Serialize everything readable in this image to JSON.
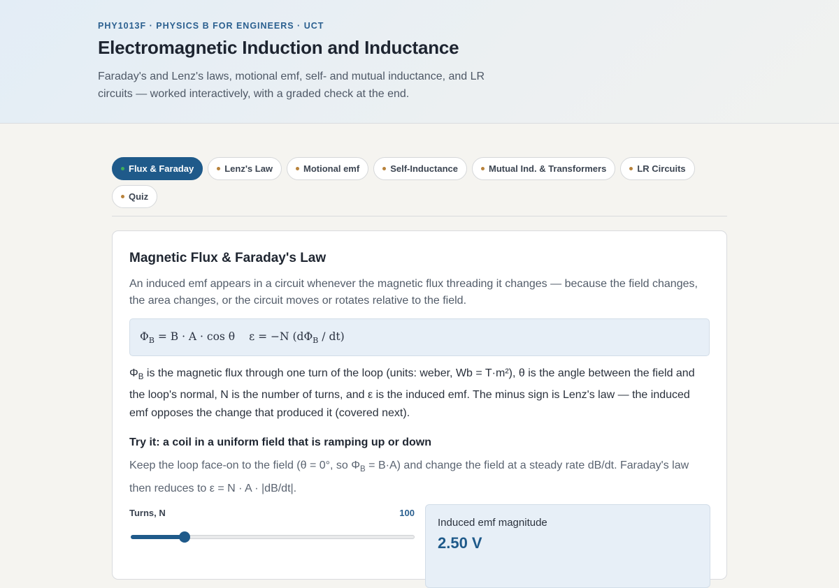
{
  "header": {
    "eyebrow": "PHY1013F · PHYSICS B FOR ENGINEERS · UCT",
    "title": "Electromagnetic Induction and Inductance",
    "subtitle": "Faraday's and Lenz's laws, motional emf, self- and mutual inductance, and LR circuits — worked interactively, with a graded check at the end."
  },
  "tabs": [
    {
      "label": "Flux & Faraday",
      "active": true
    },
    {
      "label": "Lenz's Law",
      "active": false
    },
    {
      "label": "Motional emf",
      "active": false
    },
    {
      "label": "Self-Inductance",
      "active": false
    },
    {
      "label": "Mutual Ind. & Transformers",
      "active": false
    },
    {
      "label": "LR Circuits",
      "active": false
    },
    {
      "label": "Quiz",
      "active": false
    }
  ],
  "section": {
    "title": "Magnetic Flux & Faraday's Law",
    "lead": "An induced emf appears in a circuit whenever the magnetic flux threading it changes — because the field changes, the area changes, or the circuit moves or rotates relative to the field.",
    "formula": {
      "flux_lhs": "Φ",
      "flux_sub": "B",
      "flux_rhs": " = B · A · cos θ",
      "emf_lhs": "ε = −N (dΦ",
      "emf_sub": "B",
      "emf_rhs": " / dt)"
    },
    "description": {
      "sym": "Φ",
      "sub": "B",
      "text": " is the magnetic flux through one turn of the loop (units: weber, Wb = T·m²), θ is the angle between the field and the loop's normal, N is the number of turns, and ε is the induced emf. The minus sign is Lenz's law — the induced emf opposes the change that produced it (covered next)."
    },
    "try_title": "Try it: a coil in a uniform field that is ramping up or down",
    "hint": {
      "before": "Keep the loop face-on to the field (θ = 0°, so Φ",
      "sub": "B",
      "after": " = B·A) and change the field at a steady rate dB/dt. Faraday's law then reduces to ε = N · A · |dB/dt|."
    },
    "control": {
      "label": "Turns, N",
      "value": "100",
      "min": 0,
      "max": 500,
      "current": 100
    },
    "result": {
      "label": "Induced emf magnitude",
      "value": "2.50 V"
    }
  },
  "colors": {
    "accent": "#1f5a8a",
    "active_dot": "#3fae5a",
    "inactive_dot": "#b8823b"
  }
}
